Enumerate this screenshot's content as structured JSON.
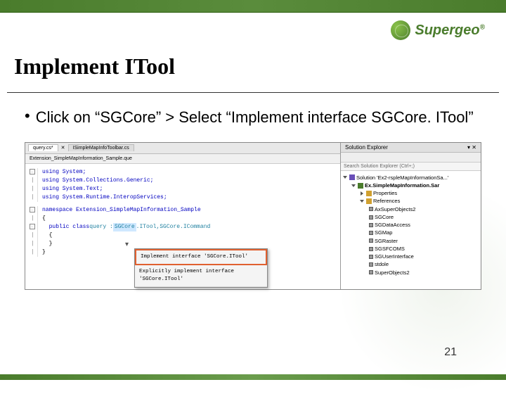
{
  "brand": {
    "name": "Supergeo",
    "reg": "®"
  },
  "title": "Implement ITool",
  "bullet": "Click on “SGCore” > Select “Implement interface SGCore. ITool”",
  "page": "21",
  "ide": {
    "tabs": {
      "active": "query.cs*",
      "inactive": "ISimpleMapInfoToolbar.cs"
    },
    "extbar": "Extension_SimpleMapInformation_Sample.que",
    "code": {
      "l1": "using System;",
      "l2": "using System.Collections.Generic;",
      "l3": "using System.Text;",
      "l4": "using System.Runtime.InteropServices;",
      "l5": "namespace Extension_SimpleMapInformation_Sample",
      "l6": "{",
      "l7a": "public class",
      "l7b": "query :",
      "l7c": "SGCore",
      "l7d": ".ITool,",
      "l7e": "SGCore.ICommand",
      "l8": "{",
      "l9": "}",
      "l10": "}"
    },
    "ctx": {
      "item1": "Implement interface 'SGCore.ITool'",
      "item2": "Explicitly implement interface 'SGCore.ITool'"
    },
    "explorer": {
      "title": "Solution Explorer",
      "search": "Search Solution Explorer (Ctrl+;)",
      "sol": "Solution 'Ex2-rspleMapInformationSa...'",
      "proj": "Ex.SimpleMapInformation.Sar",
      "props": "Properties",
      "refs": "References",
      "r1": "AxSuperObjects2",
      "r2": "SGCore",
      "r3": "SGDataAccess",
      "r4": "SGMap",
      "r5": "SGRaster",
      "r6": "SGSFCOMS",
      "r7": "SGUserInterface",
      "r8": "stdole",
      "r9": "SuperObjects2"
    }
  }
}
